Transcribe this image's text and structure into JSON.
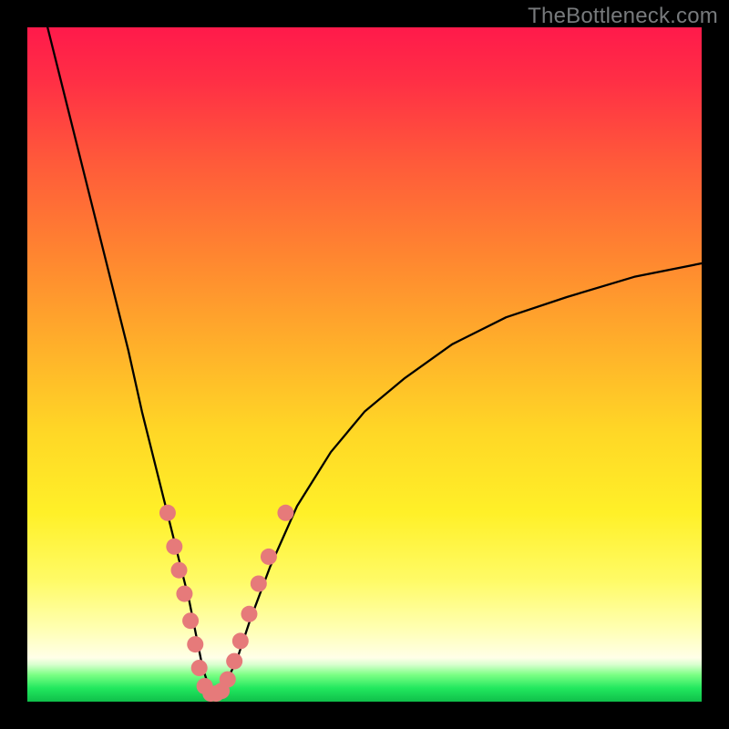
{
  "watermark": "TheBottleneck.com",
  "chart_data": {
    "type": "line",
    "title": "",
    "xlabel": "",
    "ylabel": "",
    "xlim": [
      0,
      100
    ],
    "ylim": [
      0,
      100
    ],
    "series": [
      {
        "name": "bottleneck-curve",
        "x": [
          3,
          6,
          9,
          12,
          15,
          17,
          19,
          21,
          22.5,
          24,
          25,
          26,
          27,
          28,
          29,
          31,
          33,
          36,
          40,
          45,
          50,
          56,
          63,
          71,
          80,
          90,
          100
        ],
        "y": [
          100,
          88,
          76,
          64,
          52,
          43,
          35,
          27,
          21,
          15,
          10,
          5,
          2,
          1,
          2,
          6,
          12,
          20,
          29,
          37,
          43,
          48,
          53,
          57,
          60,
          63,
          65
        ]
      }
    ],
    "markers": {
      "name": "highlight-points",
      "color": "#e67a7a",
      "radius_px": 9,
      "points": [
        {
          "x": 20.8,
          "y": 28
        },
        {
          "x": 21.8,
          "y": 23
        },
        {
          "x": 22.5,
          "y": 19.5
        },
        {
          "x": 23.3,
          "y": 16
        },
        {
          "x": 24.2,
          "y": 12
        },
        {
          "x": 24.9,
          "y": 8.5
        },
        {
          "x": 25.5,
          "y": 5
        },
        {
          "x": 26.3,
          "y": 2.3
        },
        {
          "x": 27.2,
          "y": 1.2
        },
        {
          "x": 28.0,
          "y": 1.2
        },
        {
          "x": 28.8,
          "y": 1.6
        },
        {
          "x": 29.7,
          "y": 3.3
        },
        {
          "x": 30.7,
          "y": 6
        },
        {
          "x": 31.6,
          "y": 9
        },
        {
          "x": 32.9,
          "y": 13
        },
        {
          "x": 34.3,
          "y": 17.5
        },
        {
          "x": 35.8,
          "y": 21.5
        },
        {
          "x": 38.3,
          "y": 28
        }
      ]
    }
  }
}
